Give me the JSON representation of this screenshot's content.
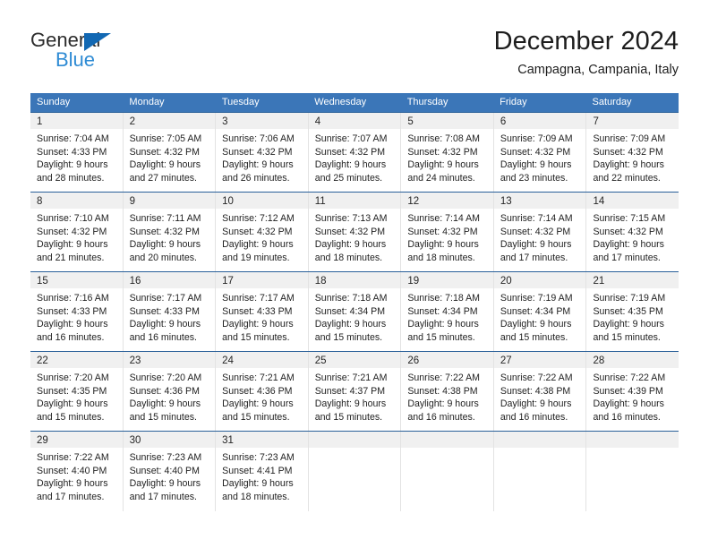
{
  "logo": {
    "word_one": "General",
    "word_two": "Blue",
    "triangle_icon": "triangle-icon",
    "brand_dark": "#2b2b2b",
    "brand_blue": "#2e8bd4",
    "triangle_blue": "#1268b3"
  },
  "header": {
    "title": "December 2024",
    "subtitle": "Campagna, Campania, Italy"
  },
  "theme": {
    "header_blue": "#3b76b8",
    "row_divider_blue": "#2a6099",
    "day_band_gray": "#f0f0f0",
    "column_divider": "#e3e3e3"
  },
  "weekdays": [
    "Sunday",
    "Monday",
    "Tuesday",
    "Wednesday",
    "Thursday",
    "Friday",
    "Saturday"
  ],
  "weeks": [
    [
      {
        "day": "1",
        "sunrise": "Sunrise: 7:04 AM",
        "sunset": "Sunset: 4:33 PM",
        "daylight": "Daylight: 9 hours",
        "minutes": "and 28 minutes."
      },
      {
        "day": "2",
        "sunrise": "Sunrise: 7:05 AM",
        "sunset": "Sunset: 4:32 PM",
        "daylight": "Daylight: 9 hours",
        "minutes": "and 27 minutes."
      },
      {
        "day": "3",
        "sunrise": "Sunrise: 7:06 AM",
        "sunset": "Sunset: 4:32 PM",
        "daylight": "Daylight: 9 hours",
        "minutes": "and 26 minutes."
      },
      {
        "day": "4",
        "sunrise": "Sunrise: 7:07 AM",
        "sunset": "Sunset: 4:32 PM",
        "daylight": "Daylight: 9 hours",
        "minutes": "and 25 minutes."
      },
      {
        "day": "5",
        "sunrise": "Sunrise: 7:08 AM",
        "sunset": "Sunset: 4:32 PM",
        "daylight": "Daylight: 9 hours",
        "minutes": "and 24 minutes."
      },
      {
        "day": "6",
        "sunrise": "Sunrise: 7:09 AM",
        "sunset": "Sunset: 4:32 PM",
        "daylight": "Daylight: 9 hours",
        "minutes": "and 23 minutes."
      },
      {
        "day": "7",
        "sunrise": "Sunrise: 7:09 AM",
        "sunset": "Sunset: 4:32 PM",
        "daylight": "Daylight: 9 hours",
        "minutes": "and 22 minutes."
      }
    ],
    [
      {
        "day": "8",
        "sunrise": "Sunrise: 7:10 AM",
        "sunset": "Sunset: 4:32 PM",
        "daylight": "Daylight: 9 hours",
        "minutes": "and 21 minutes."
      },
      {
        "day": "9",
        "sunrise": "Sunrise: 7:11 AM",
        "sunset": "Sunset: 4:32 PM",
        "daylight": "Daylight: 9 hours",
        "minutes": "and 20 minutes."
      },
      {
        "day": "10",
        "sunrise": "Sunrise: 7:12 AM",
        "sunset": "Sunset: 4:32 PM",
        "daylight": "Daylight: 9 hours",
        "minutes": "and 19 minutes."
      },
      {
        "day": "11",
        "sunrise": "Sunrise: 7:13 AM",
        "sunset": "Sunset: 4:32 PM",
        "daylight": "Daylight: 9 hours",
        "minutes": "and 18 minutes."
      },
      {
        "day": "12",
        "sunrise": "Sunrise: 7:14 AM",
        "sunset": "Sunset: 4:32 PM",
        "daylight": "Daylight: 9 hours",
        "minutes": "and 18 minutes."
      },
      {
        "day": "13",
        "sunrise": "Sunrise: 7:14 AM",
        "sunset": "Sunset: 4:32 PM",
        "daylight": "Daylight: 9 hours",
        "minutes": "and 17 minutes."
      },
      {
        "day": "14",
        "sunrise": "Sunrise: 7:15 AM",
        "sunset": "Sunset: 4:32 PM",
        "daylight": "Daylight: 9 hours",
        "minutes": "and 17 minutes."
      }
    ],
    [
      {
        "day": "15",
        "sunrise": "Sunrise: 7:16 AM",
        "sunset": "Sunset: 4:33 PM",
        "daylight": "Daylight: 9 hours",
        "minutes": "and 16 minutes."
      },
      {
        "day": "16",
        "sunrise": "Sunrise: 7:17 AM",
        "sunset": "Sunset: 4:33 PM",
        "daylight": "Daylight: 9 hours",
        "minutes": "and 16 minutes."
      },
      {
        "day": "17",
        "sunrise": "Sunrise: 7:17 AM",
        "sunset": "Sunset: 4:33 PM",
        "daylight": "Daylight: 9 hours",
        "minutes": "and 15 minutes."
      },
      {
        "day": "18",
        "sunrise": "Sunrise: 7:18 AM",
        "sunset": "Sunset: 4:34 PM",
        "daylight": "Daylight: 9 hours",
        "minutes": "and 15 minutes."
      },
      {
        "day": "19",
        "sunrise": "Sunrise: 7:18 AM",
        "sunset": "Sunset: 4:34 PM",
        "daylight": "Daylight: 9 hours",
        "minutes": "and 15 minutes."
      },
      {
        "day": "20",
        "sunrise": "Sunrise: 7:19 AM",
        "sunset": "Sunset: 4:34 PM",
        "daylight": "Daylight: 9 hours",
        "minutes": "and 15 minutes."
      },
      {
        "day": "21",
        "sunrise": "Sunrise: 7:19 AM",
        "sunset": "Sunset: 4:35 PM",
        "daylight": "Daylight: 9 hours",
        "minutes": "and 15 minutes."
      }
    ],
    [
      {
        "day": "22",
        "sunrise": "Sunrise: 7:20 AM",
        "sunset": "Sunset: 4:35 PM",
        "daylight": "Daylight: 9 hours",
        "minutes": "and 15 minutes."
      },
      {
        "day": "23",
        "sunrise": "Sunrise: 7:20 AM",
        "sunset": "Sunset: 4:36 PM",
        "daylight": "Daylight: 9 hours",
        "minutes": "and 15 minutes."
      },
      {
        "day": "24",
        "sunrise": "Sunrise: 7:21 AM",
        "sunset": "Sunset: 4:36 PM",
        "daylight": "Daylight: 9 hours",
        "minutes": "and 15 minutes."
      },
      {
        "day": "25",
        "sunrise": "Sunrise: 7:21 AM",
        "sunset": "Sunset: 4:37 PM",
        "daylight": "Daylight: 9 hours",
        "minutes": "and 15 minutes."
      },
      {
        "day": "26",
        "sunrise": "Sunrise: 7:22 AM",
        "sunset": "Sunset: 4:38 PM",
        "daylight": "Daylight: 9 hours",
        "minutes": "and 16 minutes."
      },
      {
        "day": "27",
        "sunrise": "Sunrise: 7:22 AM",
        "sunset": "Sunset: 4:38 PM",
        "daylight": "Daylight: 9 hours",
        "minutes": "and 16 minutes."
      },
      {
        "day": "28",
        "sunrise": "Sunrise: 7:22 AM",
        "sunset": "Sunset: 4:39 PM",
        "daylight": "Daylight: 9 hours",
        "minutes": "and 16 minutes."
      }
    ],
    [
      {
        "day": "29",
        "sunrise": "Sunrise: 7:22 AM",
        "sunset": "Sunset: 4:40 PM",
        "daylight": "Daylight: 9 hours",
        "minutes": "and 17 minutes."
      },
      {
        "day": "30",
        "sunrise": "Sunrise: 7:23 AM",
        "sunset": "Sunset: 4:40 PM",
        "daylight": "Daylight: 9 hours",
        "minutes": "and 17 minutes."
      },
      {
        "day": "31",
        "sunrise": "Sunrise: 7:23 AM",
        "sunset": "Sunset: 4:41 PM",
        "daylight": "Daylight: 9 hours",
        "minutes": "and 18 minutes."
      },
      {
        "day": "",
        "sunrise": "",
        "sunset": "",
        "daylight": "",
        "minutes": ""
      },
      {
        "day": "",
        "sunrise": "",
        "sunset": "",
        "daylight": "",
        "minutes": ""
      },
      {
        "day": "",
        "sunrise": "",
        "sunset": "",
        "daylight": "",
        "minutes": ""
      },
      {
        "day": "",
        "sunrise": "",
        "sunset": "",
        "daylight": "",
        "minutes": ""
      }
    ]
  ]
}
